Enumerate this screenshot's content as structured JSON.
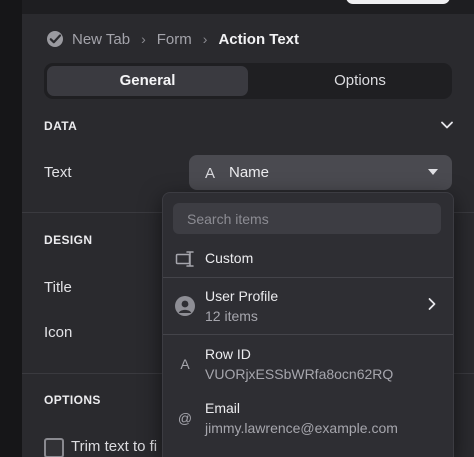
{
  "breadcrumb": {
    "items": [
      "New Tab",
      "Form"
    ],
    "current": "Action Text",
    "separator": "›"
  },
  "tabs": [
    {
      "label": "General",
      "active": true
    },
    {
      "label": "Options",
      "active": false
    }
  ],
  "sections": {
    "data": "DATA",
    "design": "DESIGN",
    "options": "OPTIONS"
  },
  "fields": {
    "text_label": "Text",
    "title_label": "Title",
    "icon_label": "Icon"
  },
  "select": {
    "type_icon": "A",
    "value": "Name"
  },
  "checkbox": {
    "label": "Trim text to fi",
    "checked": false
  },
  "dropdown": {
    "search_placeholder": "Search items",
    "items": [
      {
        "title": "Custom",
        "icon": "custom-field-icon"
      },
      {
        "title": "User Profile",
        "subtitle": "12 items",
        "icon": "user-avatar-icon",
        "has_submenu": true
      },
      {
        "title": "Row ID",
        "subtitle": "VUORjxESSbWRfa8ocn62RQ",
        "icon": "A"
      },
      {
        "title": "Email",
        "subtitle": "jimmy.lawrence@example.com",
        "icon": "@"
      }
    ]
  },
  "colors": {
    "background": "#2a2a2e",
    "dropdown": "#2e2e33",
    "select": "#4a4a50",
    "active_tab": "#3a3a40"
  }
}
